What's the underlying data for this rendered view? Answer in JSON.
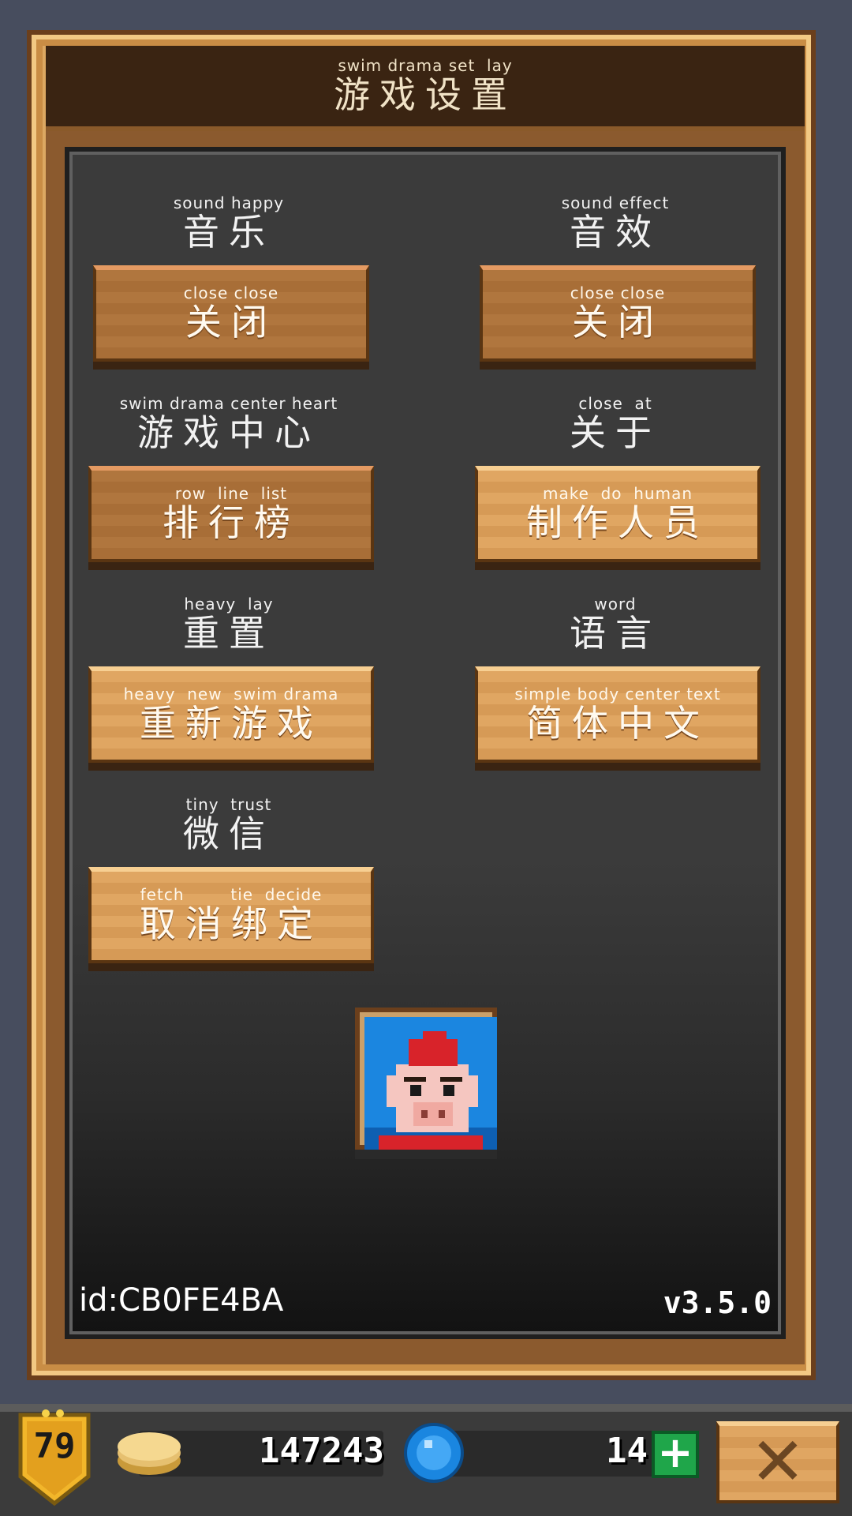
{
  "header": {
    "gloss": "swim drama set  lay",
    "title": "游戏设置"
  },
  "settings": [
    {
      "label_gloss": "sound happy",
      "label": "音乐",
      "button_gloss": "close close",
      "button": "关闭",
      "style": "dark"
    },
    {
      "label_gloss": "sound effect",
      "label": "音效",
      "button_gloss": "close close",
      "button": "关闭",
      "style": "dark"
    },
    {
      "label_gloss": "swim drama center heart",
      "label": "游戏中心",
      "button_gloss": "row  line  list",
      "button": "排行榜",
      "style": "dark"
    },
    {
      "label_gloss": "close  at",
      "label": "关于",
      "button_gloss": "make  do  human",
      "button": "制作人员",
      "style": "light"
    },
    {
      "label_gloss": "heavy  lay",
      "label": "重置",
      "button_gloss": "heavy  new  swim drama",
      "button": "重新游戏",
      "style": "light"
    },
    {
      "label_gloss": "word",
      "label": "语言",
      "button_gloss": "simple body center text",
      "button": "简体中文",
      "style": "light"
    },
    {
      "label_gloss": "tiny  trust",
      "label": "微信",
      "button_gloss": "fetch        tie  decide",
      "button": "取消绑定",
      "style": "light"
    }
  ],
  "footer": {
    "user_id": "id:CB0FE4BA",
    "version": "v3.5.0"
  },
  "bottom_bar": {
    "level": "79",
    "coins": "147243",
    "gems": "14",
    "icons": {
      "level": "shield-badge-icon",
      "coins": "gold-coin-stack-icon",
      "gems": "blue-gem-icon",
      "add": "plus-icon",
      "close": "close-x-icon"
    }
  },
  "colors": {
    "background": "#474d5e",
    "frame": "#dca862",
    "panel": "#3b3b3b",
    "button_dark": "#b0763e",
    "button_light": "#e0a662",
    "plus_green": "#1fa64a"
  }
}
